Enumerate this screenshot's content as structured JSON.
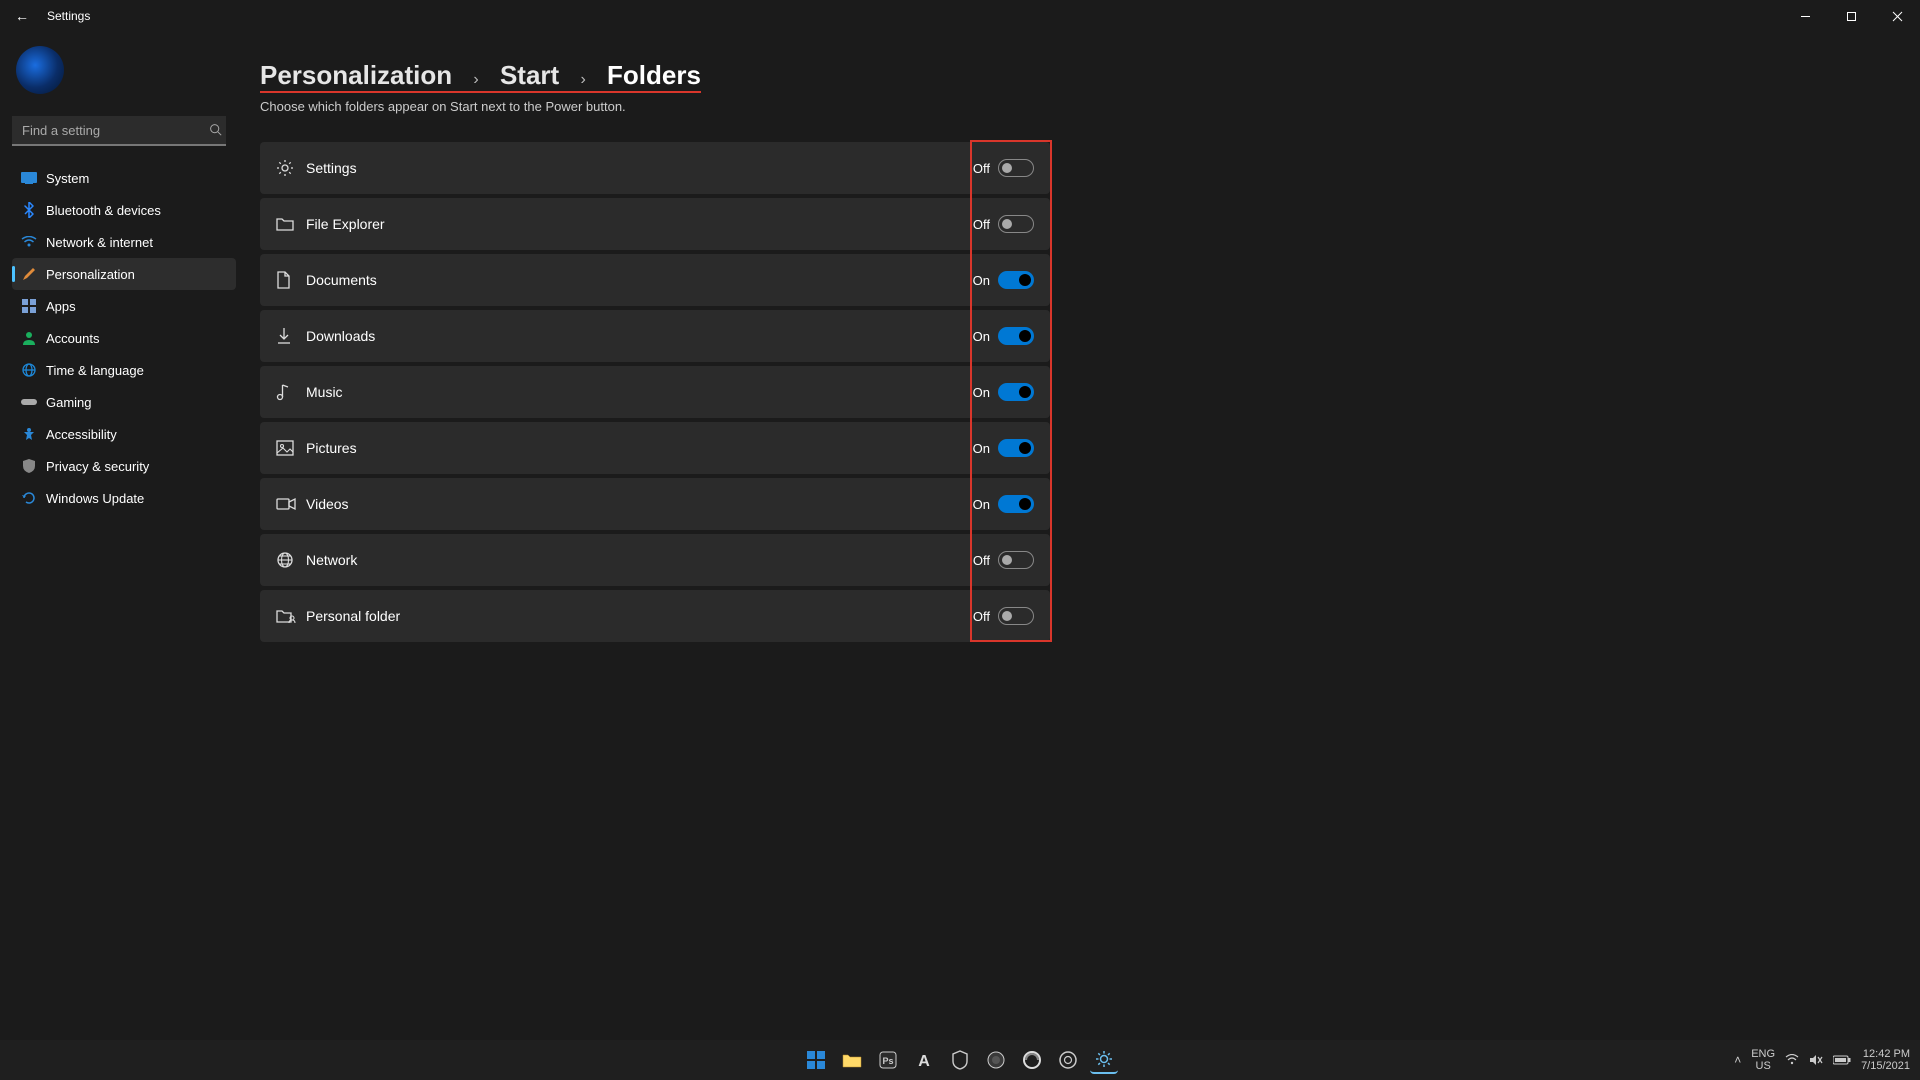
{
  "window": {
    "title": "Settings",
    "minimize": "—",
    "maximize": "▢",
    "close": "✕"
  },
  "search": {
    "placeholder": "Find a setting"
  },
  "sidebar": {
    "items": [
      {
        "label": "System"
      },
      {
        "label": "Bluetooth & devices"
      },
      {
        "label": "Network & internet"
      },
      {
        "label": "Personalization"
      },
      {
        "label": "Apps"
      },
      {
        "label": "Accounts"
      },
      {
        "label": "Time & language"
      },
      {
        "label": "Gaming"
      },
      {
        "label": "Accessibility"
      },
      {
        "label": "Privacy & security"
      },
      {
        "label": "Windows Update"
      }
    ]
  },
  "breadcrumb": {
    "parent1": "Personalization",
    "parent2": "Start",
    "current": "Folders"
  },
  "subtitle": "Choose which folders appear on Start next to the Power button.",
  "rows": [
    {
      "label": "Settings",
      "state": "Off",
      "on": false
    },
    {
      "label": "File Explorer",
      "state": "Off",
      "on": false
    },
    {
      "label": "Documents",
      "state": "On",
      "on": true
    },
    {
      "label": "Downloads",
      "state": "On",
      "on": true
    },
    {
      "label": "Music",
      "state": "On",
      "on": true
    },
    {
      "label": "Pictures",
      "state": "On",
      "on": true
    },
    {
      "label": "Videos",
      "state": "On",
      "on": true
    },
    {
      "label": "Network",
      "state": "Off",
      "on": false
    },
    {
      "label": "Personal folder",
      "state": "Off",
      "on": false
    }
  ],
  "taskbar": {
    "lang_top": "ENG",
    "lang_bot": "US",
    "time": "12:42 PM",
    "date": "7/15/2021"
  }
}
